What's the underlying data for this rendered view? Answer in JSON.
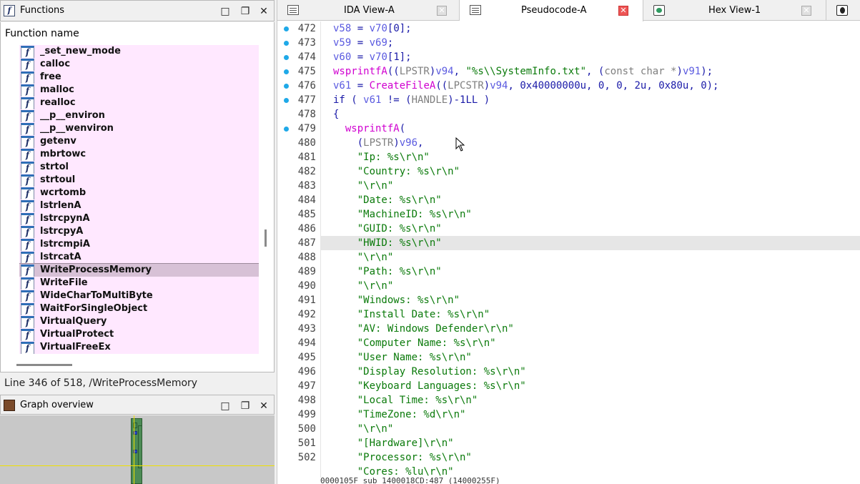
{
  "functions_panel": {
    "title": "Functions",
    "column_header": "Function name",
    "items": [
      "_set_new_mode",
      "calloc",
      "free",
      "malloc",
      "realloc",
      "__p__environ",
      "__p__wenviron",
      "getenv",
      "mbrtowc",
      "strtol",
      "strtoul",
      "wcrtomb",
      "lstrlenA",
      "lstrcpynA",
      "lstrcpyA",
      "lstrcmpiA",
      "lstrcatA",
      "WriteProcessMemory",
      "WriteFile",
      "WideCharToMultiByte",
      "WaitForSingleObject",
      "VirtualQuery",
      "VirtualProtect",
      "VirtualFreeEx"
    ],
    "selected_item": "WriteProcessMemory",
    "icon_glyph": "f",
    "status": "Line 346 of 518, /WriteProcessMemory"
  },
  "graph_panel": {
    "title": "Graph overview"
  },
  "window_buttons": {
    "maximize": "□",
    "restore": "❐",
    "close": "✕"
  },
  "tabs": [
    {
      "label": "IDA View-A",
      "icon": "text-view-icon",
      "active": false
    },
    {
      "label": "Pseudocode-A",
      "icon": "text-view-icon",
      "active": true
    },
    {
      "label": "Hex View-1",
      "icon": "hex-view-icon",
      "active": false
    }
  ],
  "tab_close_glyph": "✕",
  "code_lines": [
    {
      "n": "472",
      "dot": true,
      "indent": 0,
      "tokens": [
        [
          "var",
          "v58"
        ],
        [
          "def",
          " = "
        ],
        [
          "var",
          "v70"
        ],
        [
          "def",
          "[0];"
        ]
      ]
    },
    {
      "n": "473",
      "dot": true,
      "indent": 0,
      "tokens": [
        [
          "var",
          "v59"
        ],
        [
          "def",
          " = "
        ],
        [
          "var",
          "v69"
        ],
        [
          "def",
          ";"
        ]
      ]
    },
    {
      "n": "474",
      "dot": true,
      "indent": 0,
      "tokens": [
        [
          "var",
          "v60"
        ],
        [
          "def",
          " = "
        ],
        [
          "var",
          "v70"
        ],
        [
          "def",
          "[1];"
        ]
      ]
    },
    {
      "n": "475",
      "dot": true,
      "indent": 0,
      "tokens": [
        [
          "fn",
          "wsprintfA"
        ],
        [
          "def",
          "(("
        ],
        [
          "cast",
          "LPSTR"
        ],
        [
          "def",
          ")"
        ],
        [
          "var",
          "v94"
        ],
        [
          "def",
          ", "
        ],
        [
          "str",
          "\"%s\\\\SystemInfo.txt\""
        ],
        [
          "def",
          ", ("
        ],
        [
          "cast",
          "const char *"
        ],
        [
          "def",
          ")"
        ],
        [
          "var",
          "v91"
        ],
        [
          "def",
          ");"
        ]
      ]
    },
    {
      "n": "476",
      "dot": true,
      "indent": 0,
      "tokens": [
        [
          "var",
          "v61"
        ],
        [
          "def",
          " = "
        ],
        [
          "fn",
          "CreateFileA"
        ],
        [
          "def",
          "(("
        ],
        [
          "cast",
          "LPCSTR"
        ],
        [
          "def",
          ")"
        ],
        [
          "var",
          "v94"
        ],
        [
          "def",
          ", 0x40000000u, 0, 0, 2u, 0x80u, 0);"
        ]
      ]
    },
    {
      "n": "477",
      "dot": true,
      "indent": 0,
      "tokens": [
        [
          "def",
          "if ( "
        ],
        [
          "var",
          "v61"
        ],
        [
          "def",
          " != ("
        ],
        [
          "cast",
          "HANDLE"
        ],
        [
          "def",
          ")-1LL )"
        ]
      ]
    },
    {
      "n": "478",
      "dot": false,
      "indent": 0,
      "tokens": [
        [
          "def",
          "{"
        ]
      ]
    },
    {
      "n": "479",
      "dot": true,
      "indent": 2,
      "tokens": [
        [
          "fn",
          "wsprintfA"
        ],
        [
          "def",
          "("
        ]
      ]
    },
    {
      "n": "480",
      "dot": false,
      "indent": 4,
      "tokens": [
        [
          "def",
          "("
        ],
        [
          "cast",
          "LPSTR"
        ],
        [
          "def",
          ")"
        ],
        [
          "var",
          "v96"
        ],
        [
          "def",
          ","
        ]
      ]
    },
    {
      "n": "481",
      "dot": false,
      "indent": 4,
      "tokens": [
        [
          "str",
          "\"Ip: %s\\r\\n\""
        ]
      ]
    },
    {
      "n": "482",
      "dot": false,
      "indent": 4,
      "tokens": [
        [
          "str",
          "\"Country: %s\\r\\n\""
        ]
      ]
    },
    {
      "n": "483",
      "dot": false,
      "indent": 4,
      "tokens": [
        [
          "str",
          "\"\\r\\n\""
        ]
      ]
    },
    {
      "n": "484",
      "dot": false,
      "indent": 4,
      "tokens": [
        [
          "str",
          "\"Date: %s\\r\\n\""
        ]
      ]
    },
    {
      "n": "485",
      "dot": false,
      "indent": 4,
      "tokens": [
        [
          "str",
          "\"MachineID: %s\\r\\n\""
        ]
      ]
    },
    {
      "n": "486",
      "dot": false,
      "indent": 4,
      "tokens": [
        [
          "str",
          "\"GUID: %s\\r\\n\""
        ]
      ]
    },
    {
      "n": "487",
      "dot": false,
      "indent": 4,
      "hl": true,
      "tokens": [
        [
          "str",
          "\"HWID: %s\\r\\n\""
        ]
      ]
    },
    {
      "n": "488",
      "dot": false,
      "indent": 4,
      "tokens": [
        [
          "str",
          "\"\\r\\n\""
        ]
      ]
    },
    {
      "n": "489",
      "dot": false,
      "indent": 4,
      "tokens": [
        [
          "str",
          "\"Path: %s\\r\\n\""
        ]
      ]
    },
    {
      "n": "490",
      "dot": false,
      "indent": 4,
      "tokens": [
        [
          "str",
          "\"\\r\\n\""
        ]
      ]
    },
    {
      "n": "491",
      "dot": false,
      "indent": 4,
      "tokens": [
        [
          "str",
          "\"Windows: %s\\r\\n\""
        ]
      ]
    },
    {
      "n": "492",
      "dot": false,
      "indent": 4,
      "tokens": [
        [
          "str",
          "\"Install Date: %s\\r\\n\""
        ]
      ]
    },
    {
      "n": "493",
      "dot": false,
      "indent": 4,
      "tokens": [
        [
          "str",
          "\"AV: Windows Defender\\r\\n\""
        ]
      ]
    },
    {
      "n": "494",
      "dot": false,
      "indent": 4,
      "tokens": [
        [
          "str",
          "\"Computer Name: %s\\r\\n\""
        ]
      ]
    },
    {
      "n": "495",
      "dot": false,
      "indent": 4,
      "tokens": [
        [
          "str",
          "\"User Name: %s\\r\\n\""
        ]
      ]
    },
    {
      "n": "496",
      "dot": false,
      "indent": 4,
      "tokens": [
        [
          "str",
          "\"Display Resolution: %s\\r\\n\""
        ]
      ]
    },
    {
      "n": "497",
      "dot": false,
      "indent": 4,
      "tokens": [
        [
          "str",
          "\"Keyboard Languages: %s\\r\\n\""
        ]
      ]
    },
    {
      "n": "498",
      "dot": false,
      "indent": 4,
      "tokens": [
        [
          "str",
          "\"Local Time: %s\\r\\n\""
        ]
      ]
    },
    {
      "n": "499",
      "dot": false,
      "indent": 4,
      "tokens": [
        [
          "str",
          "\"TimeZone: %d\\r\\n\""
        ]
      ]
    },
    {
      "n": "500",
      "dot": false,
      "indent": 4,
      "tokens": [
        [
          "str",
          "\"\\r\\n\""
        ]
      ]
    },
    {
      "n": "501",
      "dot": false,
      "indent": 4,
      "tokens": [
        [
          "str",
          "\"[Hardware]\\r\\n\""
        ]
      ]
    },
    {
      "n": "502",
      "dot": false,
      "indent": 4,
      "tokens": [
        [
          "str",
          "\"Processor: %s\\r\\n\""
        ]
      ]
    },
    {
      "n": "",
      "dot": false,
      "indent": 4,
      "tokens": [
        [
          "str",
          "\"Cores: %lu\\r\\n\""
        ]
      ]
    }
  ],
  "address_bar": "0000105F sub_1400018CD:487 (14000255F)",
  "colors": {
    "function_row_bg": "#ffe8ff",
    "selected_row_bg": "#d7c1d6",
    "breakpoint_dot": "#1fa9e8",
    "string": "#0a7a0a",
    "variable": "#5a5ae0",
    "function_call": "#d000d0",
    "cast": "#7f7f7f"
  }
}
